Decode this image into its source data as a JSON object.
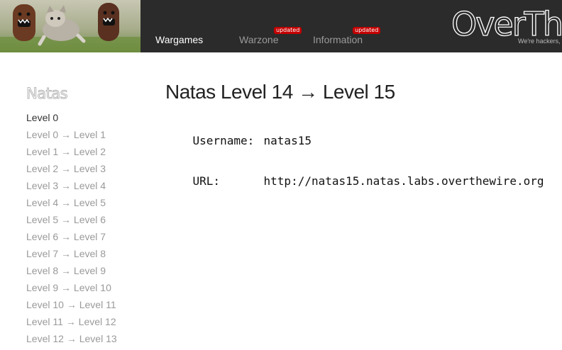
{
  "header": {
    "nav": [
      {
        "label": "Wargames",
        "badge": ""
      },
      {
        "label": "Warzone",
        "badge": "updated"
      },
      {
        "label": "Information",
        "badge": "updated"
      }
    ],
    "logo_text": "OverTh",
    "tagline": "We're hackers,"
  },
  "sidebar": {
    "title": "Natas",
    "items": [
      "Level 0",
      "Level 0 → Level 1",
      "Level 1 → Level 2",
      "Level 2 → Level 3",
      "Level 3 → Level 4",
      "Level 4 → Level 5",
      "Level 5 → Level 6",
      "Level 6 → Level 7",
      "Level 7 → Level 8",
      "Level 8 → Level 9",
      "Level 9 → Level 10",
      "Level 10 → Level 11",
      "Level 11 → Level 12",
      "Level 12 → Level 13"
    ]
  },
  "main": {
    "title": "Natas Level 14 → Level 15",
    "username_label": "Username:",
    "username_value": "natas15",
    "url_label": "URL:",
    "url_value": "http://natas15.natas.labs.overthewire.org"
  }
}
